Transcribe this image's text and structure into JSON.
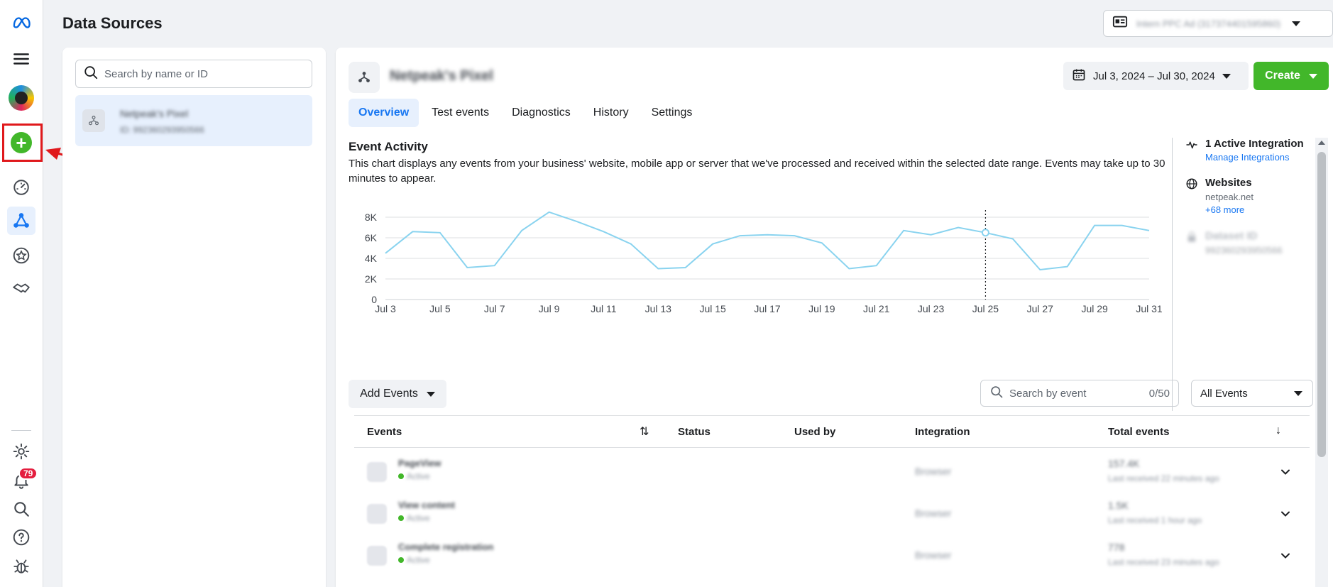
{
  "header": {
    "title": "Data Sources",
    "account_name": "Intern PPC Ad (317374401595860)"
  },
  "rail": {
    "notification_count": "79"
  },
  "list": {
    "search_placeholder": "Search by name or ID",
    "selected_item": {
      "name": "Netpeak's Pixel",
      "id": "ID: 992360293950566"
    }
  },
  "main": {
    "pixel_name": "Netpeak's Pixel",
    "date_range": "Jul 3, 2024 – Jul 30, 2024",
    "create_label": "Create",
    "tabs": [
      {
        "label": "Overview",
        "active": true
      },
      {
        "label": "Test events",
        "active": false
      },
      {
        "label": "Diagnostics",
        "active": false
      },
      {
        "label": "History",
        "active": false
      },
      {
        "label": "Settings",
        "active": false
      }
    ],
    "activity_title": "Event Activity",
    "activity_desc": "This chart displays any events from your business' website, mobile app or server that we've processed and received within the selected date range. Events may take up to 30 minutes to appear."
  },
  "side_info": {
    "integration_title": "1 Active Integration",
    "integration_link": "Manage Integrations",
    "websites_title": "Websites",
    "websites_domain": "netpeak.net",
    "websites_more": "+68 more",
    "dataset_title": "Dataset ID",
    "dataset_id": "992360293950566"
  },
  "events_toolbar": {
    "add_events_label": "Add Events",
    "search_placeholder": "Search by event",
    "search_count": "0/50",
    "filter_label": "All Events"
  },
  "table": {
    "headers": {
      "events": "Events",
      "status": "Status",
      "used_by": "Used by",
      "integration": "Integration",
      "total": "Total events"
    },
    "rows": [
      {
        "name": "PageView",
        "status": "Active",
        "integration": "Browser",
        "total": "157.4K",
        "last": "Last received 22 minutes ago"
      },
      {
        "name": "View content",
        "status": "Active",
        "integration": "Browser",
        "total": "1.5K",
        "last": "Last received 1 hour ago"
      },
      {
        "name": "Complete registration",
        "status": "Active",
        "integration": "Browser",
        "total": "778",
        "last": "Last received 23 minutes ago"
      }
    ]
  },
  "chart_data": {
    "type": "line",
    "title": "",
    "xlabel": "",
    "ylabel": "",
    "x": [
      "Jul 3",
      "Jul 4",
      "Jul 5",
      "Jul 6",
      "Jul 7",
      "Jul 8",
      "Jul 9",
      "Jul 10",
      "Jul 11",
      "Jul 12",
      "Jul 13",
      "Jul 14",
      "Jul 15",
      "Jul 16",
      "Jul 17",
      "Jul 18",
      "Jul 19",
      "Jul 20",
      "Jul 21",
      "Jul 22",
      "Jul 23",
      "Jul 24",
      "Jul 25",
      "Jul 26",
      "Jul 27",
      "Jul 28",
      "Jul 29",
      "Jul 30",
      "Jul 31"
    ],
    "x_tick_labels": [
      "Jul 3",
      "Jul 5",
      "Jul 7",
      "Jul 9",
      "Jul 11",
      "Jul 13",
      "Jul 15",
      "Jul 17",
      "Jul 19",
      "Jul 21",
      "Jul 23",
      "Jul 25",
      "Jul 27",
      "Jul 29",
      "Jul 31"
    ],
    "y_tick_labels": [
      "0",
      "2K",
      "4K",
      "6K",
      "8K"
    ],
    "ylim": [
      0,
      8000
    ],
    "grid": true,
    "series": [
      {
        "values": [
          4500,
          6600,
          6500,
          3100,
          3300,
          6700,
          8500,
          7600,
          6600,
          5400,
          3000,
          3100,
          5400,
          6200,
          6300,
          6200,
          5500,
          3000,
          3300,
          6700,
          6300,
          7000,
          6500,
          5900,
          2900,
          3200,
          7200,
          7200,
          6700
        ]
      }
    ],
    "hover_index": 22,
    "line_color": "#89d3ef"
  }
}
